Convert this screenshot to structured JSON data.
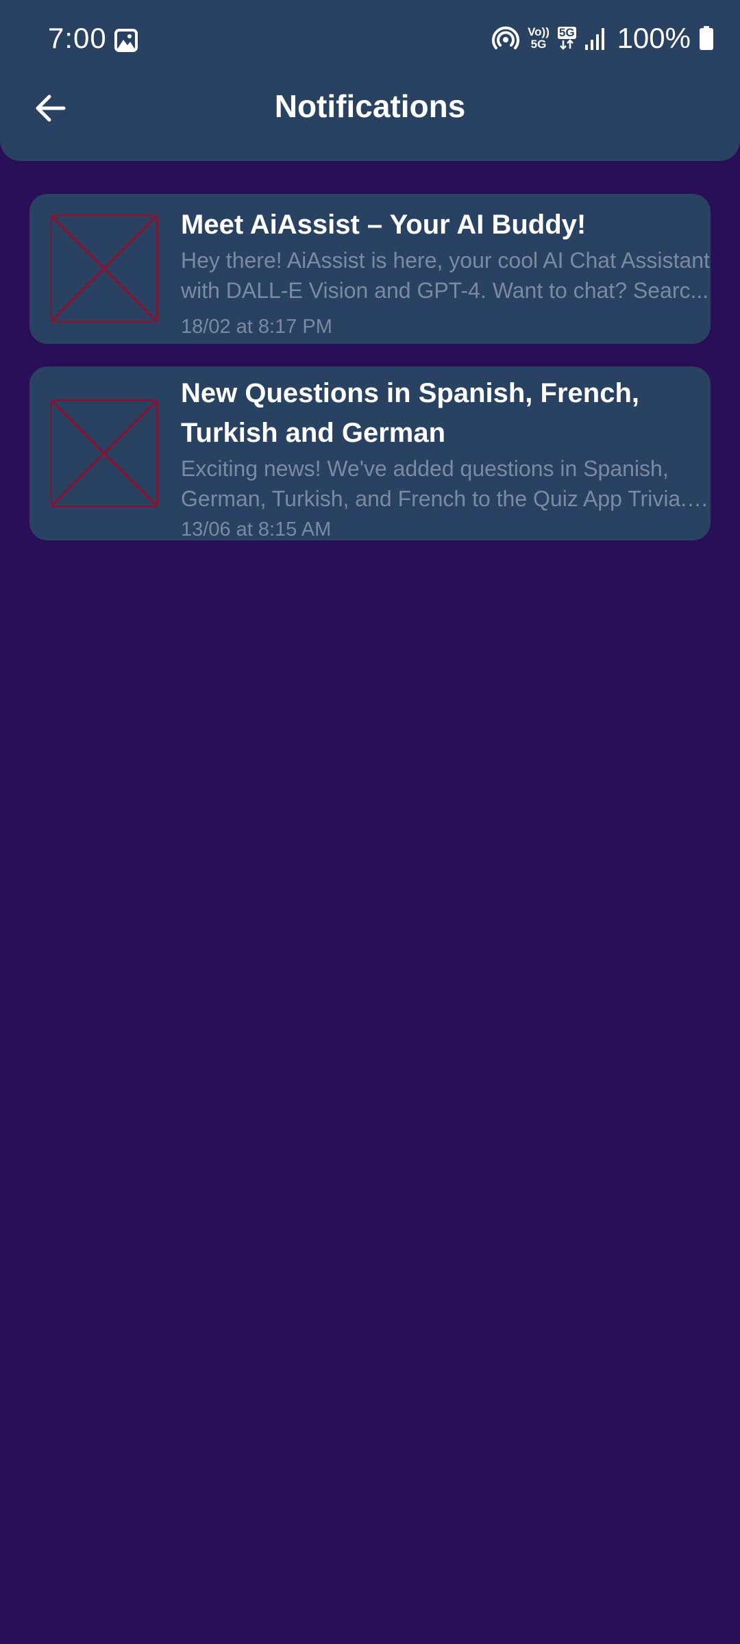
{
  "status_bar": {
    "time": "7:00",
    "icons": [
      "gallery-icon",
      "hotspot-icon",
      "volte-5g-icon",
      "5g-data-icon",
      "signal-icon",
      "battery-icon"
    ],
    "volte_label_top": "Vo))",
    "volte_label_bottom": "5G",
    "data_label": "5G",
    "battery": "100%"
  },
  "header": {
    "back_icon": "arrow-left-icon",
    "title": "Notifications"
  },
  "notifications": [
    {
      "title": "Meet AiAssist – Your AI Buddy!",
      "body_line1": "Hey there! AiAssist is here, your cool AI Chat Assistant",
      "body_line2": "with DALL-E Vision and GPT-4. Want to chat? Searc...",
      "time": "18/02 at  8:17 PM",
      "image": "broken-image-icon"
    },
    {
      "title_line1": "New Questions in Spanish, French,",
      "title_line2": "Turkish and German",
      "body_line1": "Exciting news! We've added questions in Spanish,",
      "body_line2": "German, Turkish, and French to the Quiz App Trivia. ...",
      "time": "13/06 at  8:15 AM",
      "image": "broken-image-icon"
    }
  ],
  "colors": {
    "background": "#290f58",
    "header": "#2a4261",
    "card": "#2a4261",
    "text_primary": "#ffffff",
    "text_secondary": "#7a8aa3",
    "placeholder_cross": "#7a1838"
  }
}
